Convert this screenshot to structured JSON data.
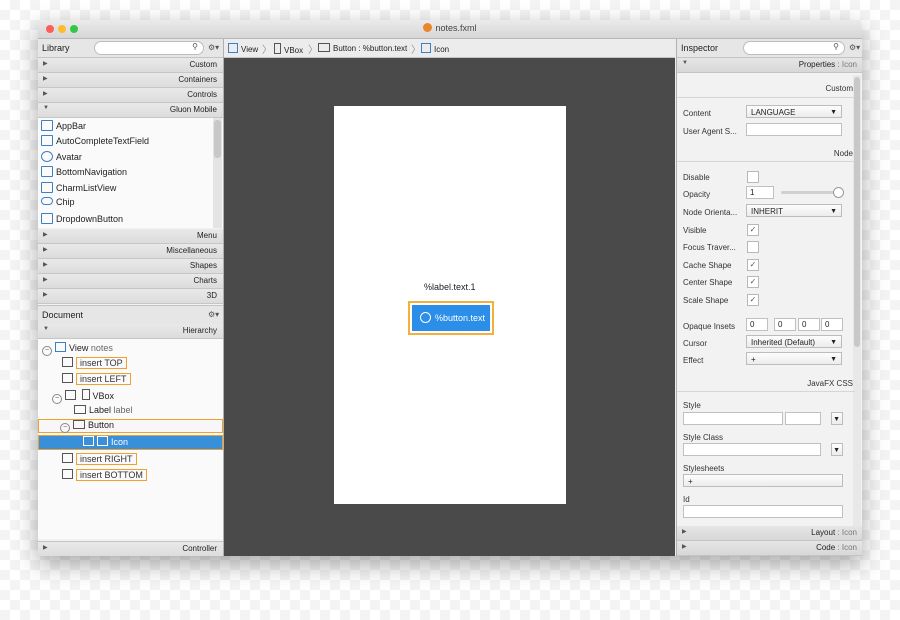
{
  "window": {
    "title": "notes.fxml",
    "lights": [
      "#fc5f57",
      "#fdbc2e",
      "#33c748"
    ]
  },
  "library": {
    "title": "Library",
    "sections_top": [
      "Custom",
      "Containers",
      "Controls",
      "Gluon Mobile"
    ],
    "items": [
      "AppBar",
      "AutoCompleteTextField",
      "Avatar",
      "BottomNavigation",
      "CharmListView",
      "Chip",
      "DropdownButton"
    ],
    "sections_bottom": [
      "Menu",
      "Miscellaneous",
      "Shapes",
      "Charts",
      "3D"
    ]
  },
  "document": {
    "title": "Document",
    "hierarchy": "Hierarchy",
    "controller": "Controller",
    "tree": {
      "view": "View",
      "view_id": "notes",
      "insert_top": "insert TOP",
      "insert_left": "insert LEFT",
      "vbox": "VBox",
      "label": "Label",
      "label_id": "label",
      "button": "Button",
      "icon": "Icon",
      "insert_right": "insert RIGHT",
      "insert_bottom": "insert BOTTOM"
    }
  },
  "breadcrumb": [
    "View",
    "VBox",
    "Button : %button.text",
    "Icon"
  ],
  "canvas": {
    "label_text": "%label.text.1",
    "button_text": "%button.text"
  },
  "inspector": {
    "title": "Inspector",
    "properties_title": "Properties",
    "properties_target": ": Icon",
    "custom_group": "Custom",
    "content_label": "Content",
    "content_value": "LANGUAGE",
    "user_agent_label": "User Agent S...",
    "node_group": "Node",
    "disable": "Disable",
    "opacity": "Opacity",
    "opacity_value": "1",
    "node_orient": "Node Orienta...",
    "node_orient_value": "INHERIT",
    "visible": "Visible",
    "focus": "Focus Traver...",
    "cache_shape": "Cache Shape",
    "center_shape": "Center Shape",
    "scale_shape": "Scale Shape",
    "opaque_insets": "Opaque Insets",
    "insets": [
      "0",
      "0",
      "0",
      "0"
    ],
    "cursor": "Cursor",
    "cursor_value": "Inherited (Default)",
    "effect": "Effect",
    "effect_value": "+",
    "css_group": "JavaFX CSS",
    "style": "Style",
    "style_class": "Style Class",
    "stylesheets": "Stylesheets",
    "stylesheets_add": "+",
    "id": "Id",
    "layout_title": "Layout",
    "layout_target": ": Icon",
    "code_title": "Code",
    "code_target": ": Icon"
  },
  "colors": {
    "selection": "#3a90d8",
    "accent": "#2b8ee8",
    "insert_outline": "#f0a030"
  }
}
